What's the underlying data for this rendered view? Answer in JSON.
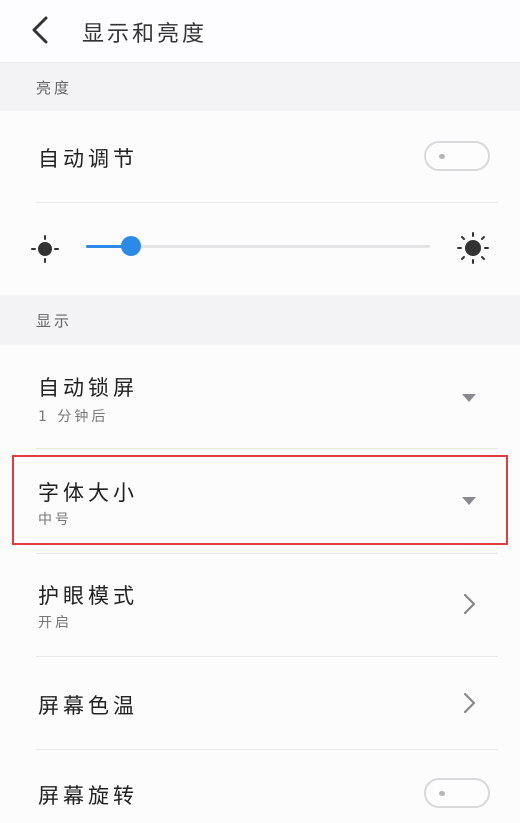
{
  "header": {
    "title": "显示和亮度",
    "back_icon": "chevron-left-icon"
  },
  "sections": {
    "brightness": "亮度",
    "display": "显示"
  },
  "auto_adjust": {
    "label": "自动调节",
    "on": false
  },
  "brightness_slider": {
    "value": 0.13,
    "low_icon": "sun-dim-icon",
    "high_icon": "sun-bright-icon",
    "accent": "#2b8ae8"
  },
  "auto_lock": {
    "label": "自动锁屏",
    "value": "1 分钟后"
  },
  "font_size": {
    "label": "字体大小",
    "value": "中号",
    "highlight_color": "#e23c3c"
  },
  "eye_mode": {
    "label": "护眼模式",
    "value": "开启"
  },
  "color_temp": {
    "label": "屏幕色温"
  },
  "rotation": {
    "label": "屏幕旋转",
    "on": false
  }
}
